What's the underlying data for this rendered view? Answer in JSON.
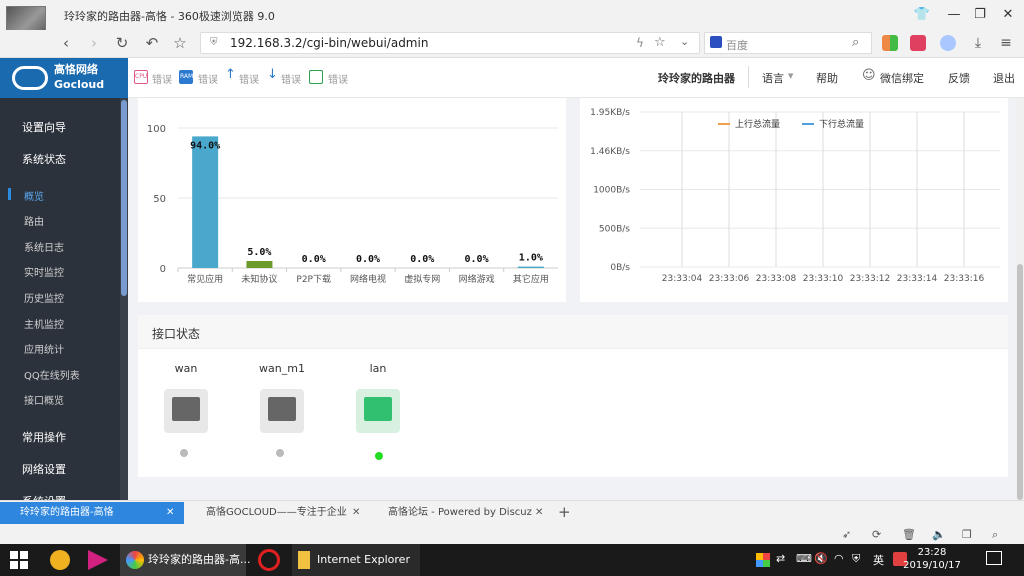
{
  "window": {
    "title": "玲玲家的路由器-高恪 - 360极速浏览器 9.0"
  },
  "nav": {
    "url": "192.168.3.2/cgi-bin/webui/admin",
    "search_placeholder": "百度"
  },
  "router": {
    "logo_cn": "高恪网络",
    "logo_en": "Gocloud",
    "status": [
      "错误",
      "错误",
      "错误",
      "错误",
      "错误"
    ],
    "status_icons": [
      "cpu-icon",
      "ram-icon",
      "upload-icon",
      "download-icon",
      "network-icon"
    ],
    "status_icon_labels": [
      "CPU",
      "RAM"
    ],
    "device_name": "玲玲家的路由器",
    "menu": [
      "语言",
      "帮助",
      "微信绑定",
      "反馈",
      "退出"
    ]
  },
  "sidebar": {
    "groups": [
      "设置向导",
      "系统状态",
      "常用操作",
      "网络设置",
      "系统设置"
    ],
    "items": [
      "概览",
      "路由",
      "系统日志",
      "实时监控",
      "历史监控",
      "主机监控",
      "应用统计",
      "QQ在线列表",
      "接口概览"
    ]
  },
  "chart_data": [
    {
      "type": "bar",
      "categories": [
        "常见应用",
        "未知协议",
        "P2P下载",
        "网络电视",
        "虚拟专网",
        "网络游戏",
        "其它应用"
      ],
      "values": [
        94.0,
        5.0,
        0.0,
        0.0,
        0.0,
        0.0,
        1.0
      ],
      "data_labels": [
        "94.0%",
        "5.0%",
        "0.0%",
        "0.0%",
        "0.0%",
        "0.0%",
        "1.0%"
      ],
      "yticks": [
        "100",
        "50",
        "0"
      ],
      "ylim": [
        0,
        100
      ],
      "colors": [
        "#4aa8cc",
        "#6b9a2a",
        "#4aa8cc",
        "#4aa8cc",
        "#4aa8cc",
        "#4aa8cc",
        "#4aa8cc"
      ]
    },
    {
      "type": "line",
      "series": [
        {
          "name": "上行总流量",
          "color": "#f0a050",
          "values": []
        },
        {
          "name": "下行总流量",
          "color": "#50a0e0",
          "values": []
        }
      ],
      "yticks": [
        "1.95KB/s",
        "1.46KB/s",
        "1000B/s",
        "500B/s",
        "0B/s"
      ],
      "x": [
        "23:33:04",
        "23:33:06",
        "23:33:08",
        "23:33:10",
        "23:33:12",
        "23:33:14",
        "23:33:16"
      ]
    }
  ],
  "interfaces": {
    "title": "接口状态",
    "ports": [
      {
        "name": "wan",
        "status": "down"
      },
      {
        "name": "wan_m1",
        "status": "down"
      },
      {
        "name": "lan",
        "status": "up"
      }
    ]
  },
  "tabs": [
    "玲玲家的路由器-高恪",
    "高恪GOCLOUD——专注于企业",
    "高恪论坛 - Powered by Discuz"
  ],
  "taskbar": {
    "apps": [
      "玲玲家的路由器-高...",
      "Internet Explorer"
    ],
    "ime": "英",
    "time": "23:28",
    "date": "2019/10/17"
  }
}
